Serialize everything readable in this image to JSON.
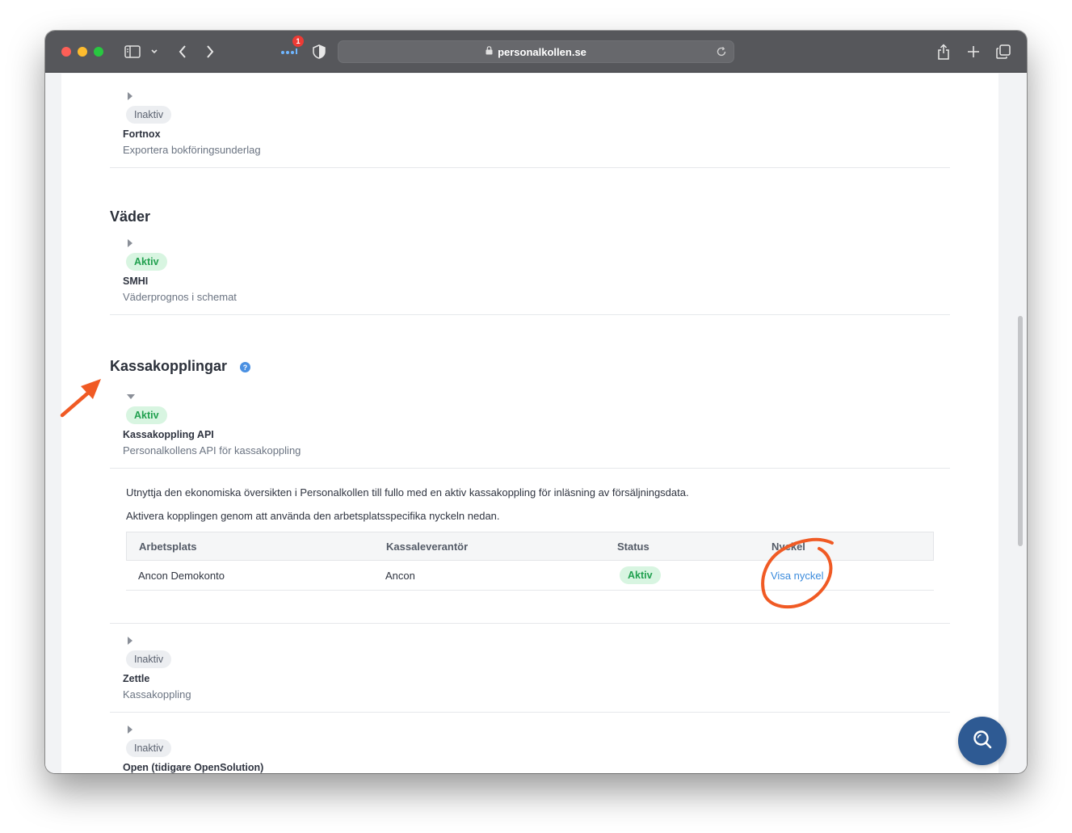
{
  "browser": {
    "url": "personalkollen.se",
    "notification_count": "1"
  },
  "sections": {
    "fortnox": {
      "status": "Inaktiv",
      "name": "Fortnox",
      "description": "Exportera bokföringsunderlag"
    },
    "vader": {
      "title": "Väder",
      "smhi": {
        "status": "Aktiv",
        "name": "SMHI",
        "description": "Väderprognos i schemat"
      }
    },
    "kassa": {
      "title": "Kassakopplingar",
      "help": "?",
      "api": {
        "status": "Aktiv",
        "name": "Kassakoppling API",
        "description": "Personalkollens API för kassakoppling",
        "para1": "Utnyttja den ekonomiska översikten i Personalkollen till fullo med en aktiv kassakoppling för inläsning av försäljningsdata.",
        "para2": "Aktivera kopplingen genom att använda den arbetsplatsspecifika nyckeln nedan.",
        "table": {
          "headers": [
            "Arbetsplats",
            "Kassaleverantör",
            "Status",
            "Nyckel"
          ],
          "row": [
            "Ancon Demokonto",
            "Ancon",
            "Aktiv",
            "Visa nyckel"
          ]
        }
      },
      "zettle": {
        "status": "Inaktiv",
        "name": "Zettle",
        "description": "Kassakoppling"
      },
      "open": {
        "status": "Inaktiv",
        "name": "Open (tidigare OpenSolution)"
      }
    }
  },
  "colors": {
    "active_green": "#21a04f",
    "link_blue": "#3b8bdc",
    "annotation_orange": "#f05a24",
    "fab_blue": "#2e5a93"
  }
}
